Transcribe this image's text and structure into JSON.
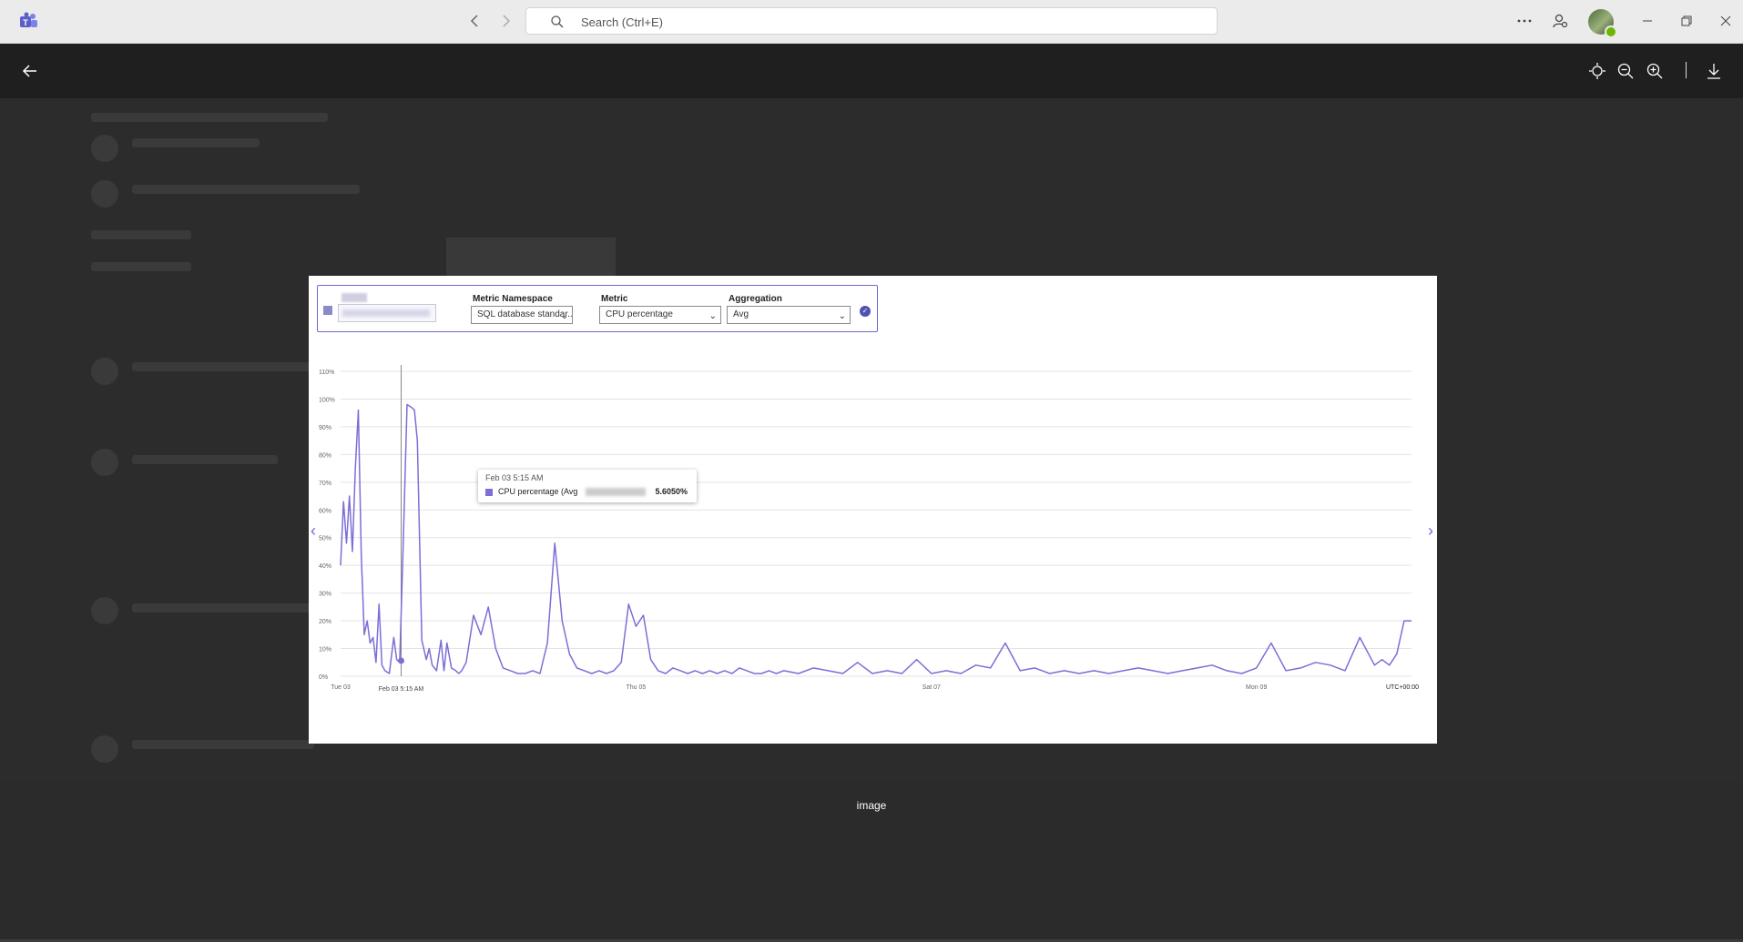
{
  "titlebar": {
    "search_placeholder": "Search (Ctrl+E)"
  },
  "icons": {
    "app": "teams-logo-icon",
    "back": "arrow-left-icon",
    "forward": "arrow-right-icon",
    "search": "search-icon",
    "more": "more-horizontal-icon",
    "profile": "people-icon",
    "fit": "fit-to-screen-icon",
    "zoom_out": "zoom-out-icon",
    "zoom_in": "zoom-in-icon",
    "download": "download-icon"
  },
  "colors": {
    "accent": "#6b69d6",
    "series": "#7b6fd6",
    "titlebar": "#ebebeb",
    "viewer_bar": "#1f1f1f"
  },
  "viewer": {
    "caption": "image"
  },
  "selectors": {
    "namespace": {
      "label": "Metric Namespace",
      "value": "SQL database standar..."
    },
    "metric": {
      "label": "Metric",
      "value": "CPU percentage"
    },
    "aggregation": {
      "label": "Aggregation",
      "value": "Avg"
    }
  },
  "tooltip": {
    "time": "Feb 03 5:15 AM",
    "series": "CPU percentage (Avg",
    "value": "5.6050%"
  },
  "chart_data": {
    "type": "line",
    "x_tick_labels": [
      "Tue 03",
      "Thu 05",
      "Sat 07",
      "Mon 09"
    ],
    "x_cursor_label": "Feb 03 5:15 AM",
    "timezone_label": "UTC+00:00",
    "y_tick_labels": [
      "0%",
      "10%",
      "20%",
      "30%",
      "40%",
      "50%",
      "60%",
      "70%",
      "80%",
      "90%",
      "100%",
      "110%"
    ],
    "ylim": [
      0,
      110
    ],
    "x_range_days": [
      0,
      7.25
    ],
    "cursor_x_day": 0.41,
    "grid": true,
    "series": [
      {
        "x_day": [
          0,
          0.02,
          0.04,
          0.06,
          0.08,
          0.1,
          0.12,
          0.14,
          0.16,
          0.18,
          0.2,
          0.22,
          0.24,
          0.26,
          0.28,
          0.3,
          0.33,
          0.36,
          0.38,
          0.4,
          0.42,
          0.45,
          0.48,
          0.5,
          0.52,
          0.55,
          0.58,
          0.6,
          0.62,
          0.65,
          0.68,
          0.7,
          0.72,
          0.75,
          0.78,
          0.8,
          0.82,
          0.85,
          0.9,
          0.95,
          1.0,
          1.05,
          1.1,
          1.15,
          1.2,
          1.25,
          1.3,
          1.35,
          1.4,
          1.45,
          1.5,
          1.55,
          1.6,
          1.65,
          1.7,
          1.75,
          1.8,
          1.85,
          1.9,
          1.95,
          2.0,
          2.05,
          2.1,
          2.15,
          2.2,
          2.25,
          2.3,
          2.35,
          2.4,
          2.45,
          2.5,
          2.55,
          2.6,
          2.65,
          2.7,
          2.75,
          2.8,
          2.85,
          2.9,
          2.95,
          3.0,
          3.1,
          3.2,
          3.3,
          3.4,
          3.5,
          3.6,
          3.7,
          3.8,
          3.9,
          4.0,
          4.1,
          4.2,
          4.3,
          4.4,
          4.5,
          4.6,
          4.7,
          4.8,
          4.9,
          5.0,
          5.1,
          5.2,
          5.3,
          5.4,
          5.5,
          5.6,
          5.7,
          5.8,
          5.9,
          6.0,
          6.1,
          6.2,
          6.3,
          6.4,
          6.5,
          6.6,
          6.7,
          6.8,
          6.9,
          7.0,
          7.05,
          7.1,
          7.15,
          7.2,
          7.25
        ],
        "y": [
          40,
          63,
          48,
          65,
          45,
          75,
          96,
          44,
          15,
          20,
          12,
          14,
          5,
          26,
          4,
          2,
          1,
          14,
          6,
          5,
          40,
          98,
          97,
          96,
          85,
          13,
          6,
          10,
          4,
          2,
          13,
          2,
          12,
          3,
          2,
          1,
          2,
          5,
          22,
          15,
          25,
          10,
          3,
          2,
          1,
          1,
          2,
          1,
          12,
          48,
          20,
          8,
          3,
          2,
          1,
          2,
          1,
          2,
          5,
          26,
          18,
          22,
          6,
          2,
          1,
          3,
          2,
          1,
          2,
          1,
          2,
          1,
          2,
          1,
          3,
          2,
          1,
          1,
          2,
          1,
          2,
          1,
          3,
          2,
          1,
          5,
          1,
          2,
          1,
          6,
          1,
          2,
          1,
          4,
          3,
          12,
          2,
          3,
          1,
          2,
          1,
          2,
          1,
          2,
          3,
          2,
          1,
          2,
          3,
          4,
          2,
          1,
          3,
          12,
          2,
          3,
          5,
          4,
          2,
          14,
          4,
          6,
          4,
          8,
          20,
          20
        ]
      }
    ]
  }
}
